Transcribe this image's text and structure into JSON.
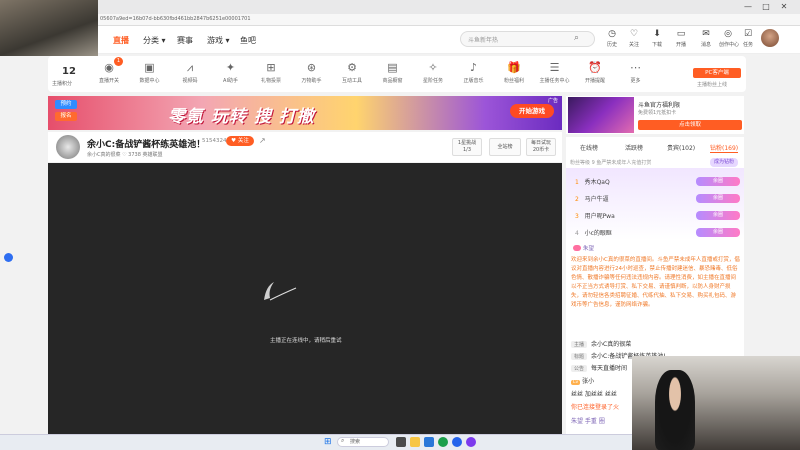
{
  "browser": {
    "url": "05607a9ed=16b07d-bb630fbd461bb2847b6251e00001701",
    "window_controls": [
      "—",
      "□",
      "✕"
    ]
  },
  "nav": {
    "live": "直播",
    "category": "分类",
    "events": "赛事",
    "games": "游戏",
    "fishbar": "鱼吧",
    "search_placeholder": "斗鱼新年热",
    "top_icons": [
      {
        "label": "历史",
        "icon": "history-icon",
        "glyph": "◷"
      },
      {
        "label": "关注",
        "icon": "heart-icon",
        "glyph": "♡"
      },
      {
        "label": "下载",
        "icon": "download-icon",
        "glyph": "⬇"
      },
      {
        "label": "开播",
        "icon": "broadcast-icon",
        "glyph": "▭"
      },
      {
        "label": "消息",
        "icon": "message-icon",
        "glyph": "✉"
      },
      {
        "label": "创作中心",
        "icon": "creator-icon",
        "glyph": "◎"
      },
      {
        "label": "任务",
        "icon": "task-icon",
        "glyph": "☑"
      }
    ]
  },
  "tools": {
    "level_num": "12",
    "level_label": "主播积分",
    "badge_new": "1",
    "items": [
      {
        "label": "直播开关",
        "glyph": "◉"
      },
      {
        "label": "数据中心",
        "glyph": "▣"
      },
      {
        "label": "视频码",
        "glyph": "⩘"
      },
      {
        "label": "AI助手",
        "glyph": "✦"
      },
      {
        "label": "礼物投票",
        "glyph": "⊞"
      },
      {
        "label": "万物助手",
        "glyph": "⊛"
      },
      {
        "label": "互动工具",
        "glyph": "⚙"
      },
      {
        "label": "商品橱窗",
        "glyph": "▤"
      },
      {
        "label": "星阶任务",
        "glyph": "✧"
      },
      {
        "label": "正版音乐",
        "glyph": "♪"
      },
      {
        "label": "粉丝福利",
        "glyph": "🎁"
      },
      {
        "label": "主播任务中心",
        "glyph": "☰"
      },
      {
        "label": "开播提醒",
        "glyph": "⏰"
      },
      {
        "label": "更多",
        "glyph": "⋯"
      }
    ],
    "pc_button": "PC客户端",
    "pc_sub": "主播粉丝上线"
  },
  "banner": {
    "text": "零氪 玩转 搜 打撤",
    "button": "开始游戏",
    "badge1": "预约",
    "badge2": "报名",
    "ad_label": "广告"
  },
  "right_ad": {
    "title": "斗鱼官方福利限",
    "sub": "免费领1元抵扣卡",
    "button": "点击领取"
  },
  "room": {
    "title": "余小C:备战铲酱杯练英雄池！",
    "id": "5154324",
    "follow": "关注",
    "sub": "余小C真的很菜  ♡ 3738  英雄联盟",
    "box1_line1": "1星挑战",
    "box1_line2": "1/3",
    "box2": "全站榜",
    "box3_line1": "每日试玩",
    "box3_line2": "20币卡"
  },
  "video": {
    "message": "主播正在连线中，请稍后重试"
  },
  "panel": {
    "tabs": [
      "在线榜",
      "活跃榜",
      "贵宾(102)",
      "钻粉(169)"
    ],
    "rank_header": "粉丝等级    9 鱼严禁未成年人充值打赏",
    "rank_btn": "成为钻粉",
    "ranks": [
      {
        "num": "1",
        "name": "秀木QaQ",
        "badge": "余圈"
      },
      {
        "num": "2",
        "name": "马户牛逼",
        "badge": "余圈"
      },
      {
        "num": "3",
        "name": "用户昵Pwa",
        "badge": "余圈"
      },
      {
        "num": "4",
        "name": "小c的眼眶",
        "badge": "余圈"
      }
    ],
    "sys_name": "朱望",
    "welcome": "欢迎来到余小C真的很菜的直播间。斗鱼严禁未成年人直播或打赏，倡议对直播内容进行24小时巡查，禁止传播封建迷信、暴恐赌毒、低俗色情、散播诈骗等任何违法违规内容。请理性消费，如主播在直播间以不正当方式诱导打赏、私下交易、请谨慎判断，以防人身财产损失，请勿轻信各类招聘征婚、代练代抽、私下交易、购买礼包码、游戏币等广告信息，谨防网络诈骗。",
    "chat": [
      {
        "tag": "主播",
        "text": "余小C真的很菜"
      },
      {
        "tag": "标题",
        "text": "余小C:备战铲酱杯练英雄池!"
      },
      {
        "tag": "公告",
        "text": "每天直播时间"
      },
      {
        "tag": "",
        "text": "张小"
      },
      {
        "tag": "",
        "text": "丝丝 加丝丝 丝丝"
      },
      {
        "tag": "",
        "text": "你已连接登录了火"
      },
      {
        "tag": "",
        "text": "朱望 手重 圈"
      }
    ]
  },
  "taskbar": {
    "search": "搜索"
  }
}
